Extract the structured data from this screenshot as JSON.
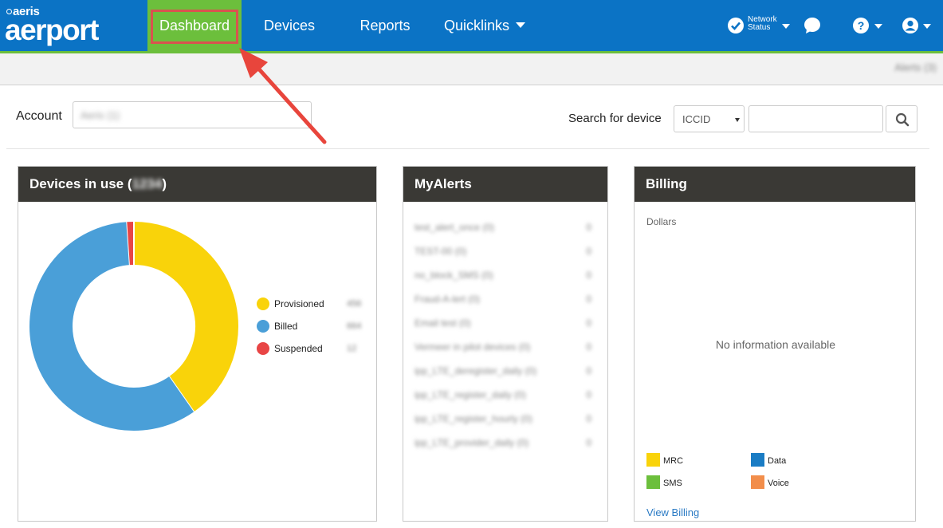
{
  "brand": {
    "small": "aeris",
    "big": "aerport"
  },
  "nav": {
    "dashboard": "Dashboard",
    "devices": "Devices",
    "reports": "Reports",
    "quicklinks": "Quicklinks"
  },
  "header_right": {
    "network_status_line1": "Network",
    "network_status_line2": "Status"
  },
  "subbar": {
    "alerts_label": "Alerts (3)"
  },
  "account": {
    "label": "Account",
    "value": "Aeris (1)"
  },
  "search": {
    "label": "Search for device",
    "type_selected": "ICCID",
    "value": ""
  },
  "devices_panel": {
    "title_prefix": "Devices in use (",
    "title_count": "1234",
    "title_suffix": ")",
    "legend": [
      {
        "label": "Provisioned",
        "value": "456",
        "color": "#f9d30a"
      },
      {
        "label": "Billed",
        "value": "664",
        "color": "#4a9fd8"
      },
      {
        "label": "Suspended",
        "value": "12",
        "color": "#e84545"
      }
    ]
  },
  "alerts_panel": {
    "title": "MyAlerts",
    "items": [
      {
        "label": "test_alert_once (0)",
        "count": "0"
      },
      {
        "label": "TEST-00 (0)",
        "count": "0"
      },
      {
        "label": "no_block_SMS (0)",
        "count": "0"
      },
      {
        "label": "Fraud-A-lert (0)",
        "count": "0"
      },
      {
        "label": "Email test (0)",
        "count": "0"
      },
      {
        "label": "Vermeer in pilot devices (0)",
        "count": "0"
      },
      {
        "label": "ipp_LTE_deregister_daily (0)",
        "count": "0"
      },
      {
        "label": "ipp_LTE_register_daily (0)",
        "count": "0"
      },
      {
        "label": "ipp_LTE_register_hourly (0)",
        "count": "0"
      },
      {
        "label": "ipp_LTE_provider_daily (0)",
        "count": "0"
      }
    ]
  },
  "billing_panel": {
    "title": "Billing",
    "unit": "Dollars",
    "empty_message": "No information available",
    "legend": [
      {
        "label": "MRC",
        "color": "#f9d30a"
      },
      {
        "label": "Data",
        "color": "#1a7cc4"
      },
      {
        "label": "SMS",
        "color": "#6cbf3c"
      },
      {
        "label": "Voice",
        "color": "#f28e4b"
      }
    ],
    "link": "View Billing"
  },
  "chart_data": {
    "type": "pie",
    "labels": [
      "Provisioned",
      "Billed",
      "Suspended"
    ],
    "values": [
      456,
      664,
      12
    ],
    "colors": [
      "#f9d30a",
      "#4a9fd8",
      "#e84545"
    ],
    "donut": true
  }
}
